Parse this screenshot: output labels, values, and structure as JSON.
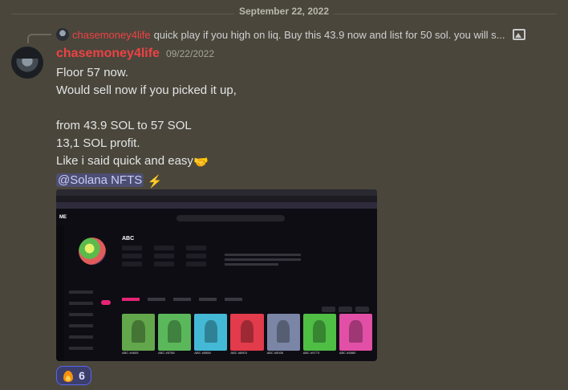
{
  "date_divider": "September 22, 2022",
  "reply": {
    "author": "chasemoney4life",
    "preview": "quick play if you high on liq. Buy this 43.9 now and list for 50 sol. you will s...",
    "attachment_icon": "image-icon"
  },
  "message": {
    "author": "chasemoney4life",
    "author_color": "#ed4245",
    "timestamp": "09/22/2022",
    "lines": [
      "Floor 57 now.",
      "Would sell now if you picked it up,",
      "",
      "from 43.9 SOL to 57 SOL",
      "13,1 SOL profit.",
      "Like i said quick and easy"
    ],
    "handshake_emoji": "🤝",
    "mention": "@Solana NFTS",
    "lightning_emoji": "⚡"
  },
  "screenshot_embed": {
    "collection_name": "ABC",
    "nft_names": [
      "ABC #4605",
      "ABC #5768",
      "ABC #5858",
      "ABC #8903",
      "ABC #5006",
      "ABC #9773",
      "ABC #5880"
    ],
    "card_colors": [
      "#62a74b",
      "#5bb85a",
      "#44b9d5",
      "#e23b4b",
      "#7b86a6",
      "#4fbe45",
      "#e24fa6"
    ]
  },
  "reaction": {
    "emoji": "fire-icon",
    "count": "6"
  }
}
